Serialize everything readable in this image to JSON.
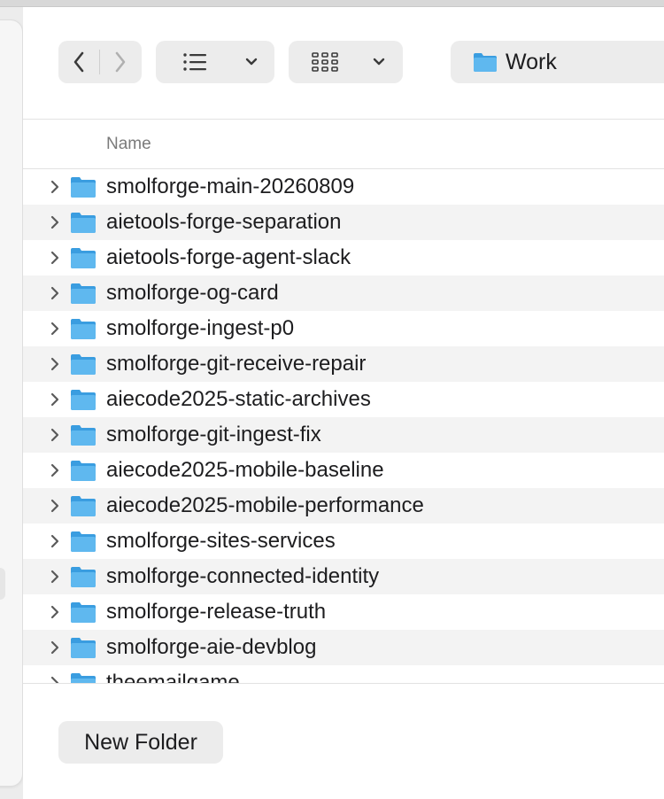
{
  "toolbar": {
    "back_icon": "chevron-left-icon",
    "forward_icon": "chevron-right-icon",
    "view_icon": "list-view-icon",
    "view_menu_icon": "chevron-down-icon",
    "group_icon": "grid-group-icon",
    "group_menu_icon": "chevron-down-icon"
  },
  "path": {
    "folder_icon": "folder-icon",
    "label": "Work"
  },
  "list": {
    "column_name": "Name",
    "rows": [
      {
        "name": "smolforge-main-20260809"
      },
      {
        "name": "aietools-forge-separation"
      },
      {
        "name": "aietools-forge-agent-slack"
      },
      {
        "name": "smolforge-og-card"
      },
      {
        "name": "smolforge-ingest-p0"
      },
      {
        "name": "smolforge-git-receive-repair"
      },
      {
        "name": "aiecode2025-static-archives"
      },
      {
        "name": "smolforge-git-ingest-fix"
      },
      {
        "name": "aiecode2025-mobile-baseline"
      },
      {
        "name": "aiecode2025-mobile-performance"
      },
      {
        "name": "smolforge-sites-services"
      },
      {
        "name": "smolforge-connected-identity"
      },
      {
        "name": "smolforge-release-truth"
      },
      {
        "name": "smolforge-aie-devblog"
      },
      {
        "name": "theemailgame"
      }
    ]
  },
  "footer": {
    "new_folder_label": "New Folder"
  },
  "colors": {
    "folder_blue": "#5fb8ef",
    "folder_blue_dark": "#3a9de0",
    "row_stripe": "#f3f3f3",
    "pill_bg": "#ececec"
  }
}
